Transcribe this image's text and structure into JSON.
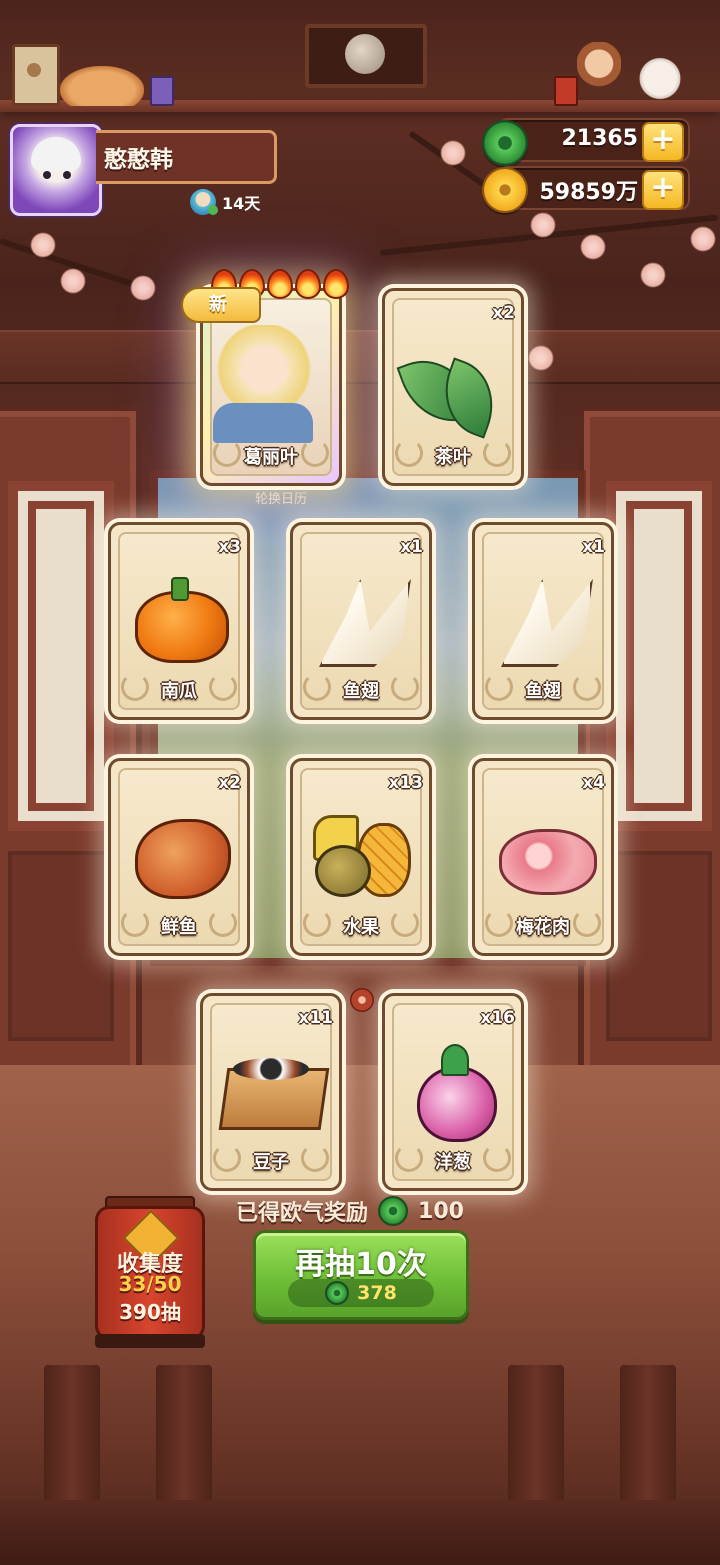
{
  "player": {
    "name": "憨憨韩",
    "days": "14天"
  },
  "currency": {
    "jade": "21365",
    "coins": "59859万"
  },
  "featured_card": {
    "badge": "新",
    "name": "葛丽叶",
    "stars": 5,
    "rotation_label": "轮换日历"
  },
  "cards": [
    {
      "name": "茶叶",
      "qty": "x2",
      "icon": "tea-leaf-icon"
    },
    {
      "name": "南瓜",
      "qty": "x3",
      "icon": "pumpkin-icon"
    },
    {
      "name": "鱼翅",
      "qty": "x1",
      "icon": "shark-fin-icon"
    },
    {
      "name": "鱼翅",
      "qty": "x1",
      "icon": "shark-fin-icon"
    },
    {
      "name": "鲜鱼",
      "qty": "x2",
      "icon": "fish-icon"
    },
    {
      "name": "水果",
      "qty": "x13",
      "icon": "fruit-icon"
    },
    {
      "name": "梅花肉",
      "qty": "x4",
      "icon": "pork-icon"
    },
    {
      "name": "豆子",
      "qty": "x11",
      "icon": "beans-icon"
    },
    {
      "name": "洋葱",
      "qty": "x16",
      "icon": "onion-icon"
    }
  ],
  "reward": {
    "label": "已得欧气奖励",
    "amount": "100"
  },
  "draw_button": {
    "label": "再抽10次",
    "cost": "378"
  },
  "collection": {
    "title": "收集度",
    "progress": "33/50",
    "draws": "390抽"
  },
  "colors": {
    "draw_button": "#6fbf38",
    "card_bg": "#f4e6c6",
    "lantern": "#d8452e"
  }
}
